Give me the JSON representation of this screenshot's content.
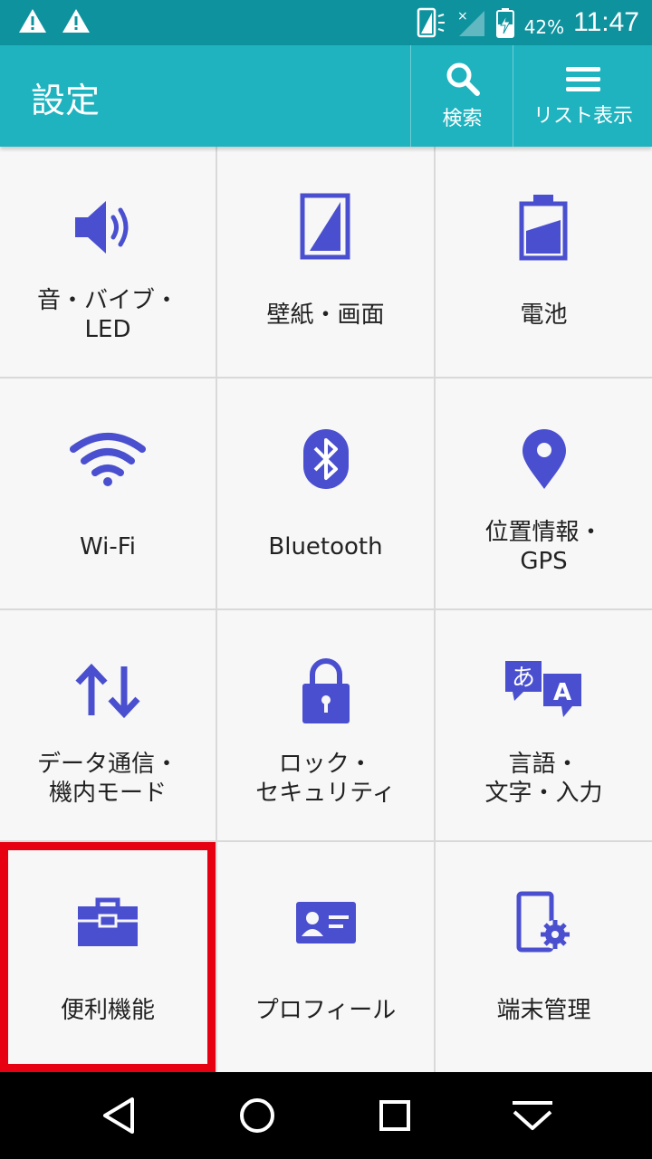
{
  "status_bar": {
    "battery_percent": "42%",
    "time": "11:47",
    "icons": [
      "warning-icon",
      "warning-icon",
      "screen-rotate-icon",
      "no-signal-icon",
      "battery-charging-icon"
    ]
  },
  "app_bar": {
    "title": "設定",
    "search_label": "検索",
    "list_label": "リスト表示"
  },
  "tiles": [
    {
      "lines": [
        "音・バイブ・",
        "LED"
      ],
      "icon": "volume-icon"
    },
    {
      "lines": [
        "壁紙・画面",
        ""
      ],
      "icon": "wallpaper-icon"
    },
    {
      "lines": [
        "電池",
        ""
      ],
      "icon": "battery-icon"
    },
    {
      "lines": [
        "Wi-Fi",
        ""
      ],
      "icon": "wifi-icon"
    },
    {
      "lines": [
        "Bluetooth",
        ""
      ],
      "icon": "bluetooth-icon"
    },
    {
      "lines": [
        "位置情報・",
        "GPS"
      ],
      "icon": "location-pin-icon"
    },
    {
      "lines": [
        "データ通信・",
        "機内モード"
      ],
      "icon": "data-transfer-icon"
    },
    {
      "lines": [
        "ロック・",
        "セキュリティ"
      ],
      "icon": "lock-icon"
    },
    {
      "lines": [
        "言語・",
        "文字・入力"
      ],
      "icon": "language-icon"
    },
    {
      "lines": [
        "便利機能",
        ""
      ],
      "icon": "toolbox-icon"
    },
    {
      "lines": [
        "プロフィール",
        ""
      ],
      "icon": "profile-card-icon"
    },
    {
      "lines": [
        "端末管理",
        ""
      ],
      "icon": "device-settings-icon"
    }
  ],
  "highlighted_tile": "便利機能",
  "colors": {
    "status_bar": "#0e939e",
    "app_bar": "#1fb3bf",
    "icon": "#4a4fcf",
    "highlight": "#e60012"
  },
  "nav_bar": {
    "buttons": [
      "back-icon",
      "home-icon",
      "recents-icon",
      "hide-nav-icon"
    ]
  }
}
